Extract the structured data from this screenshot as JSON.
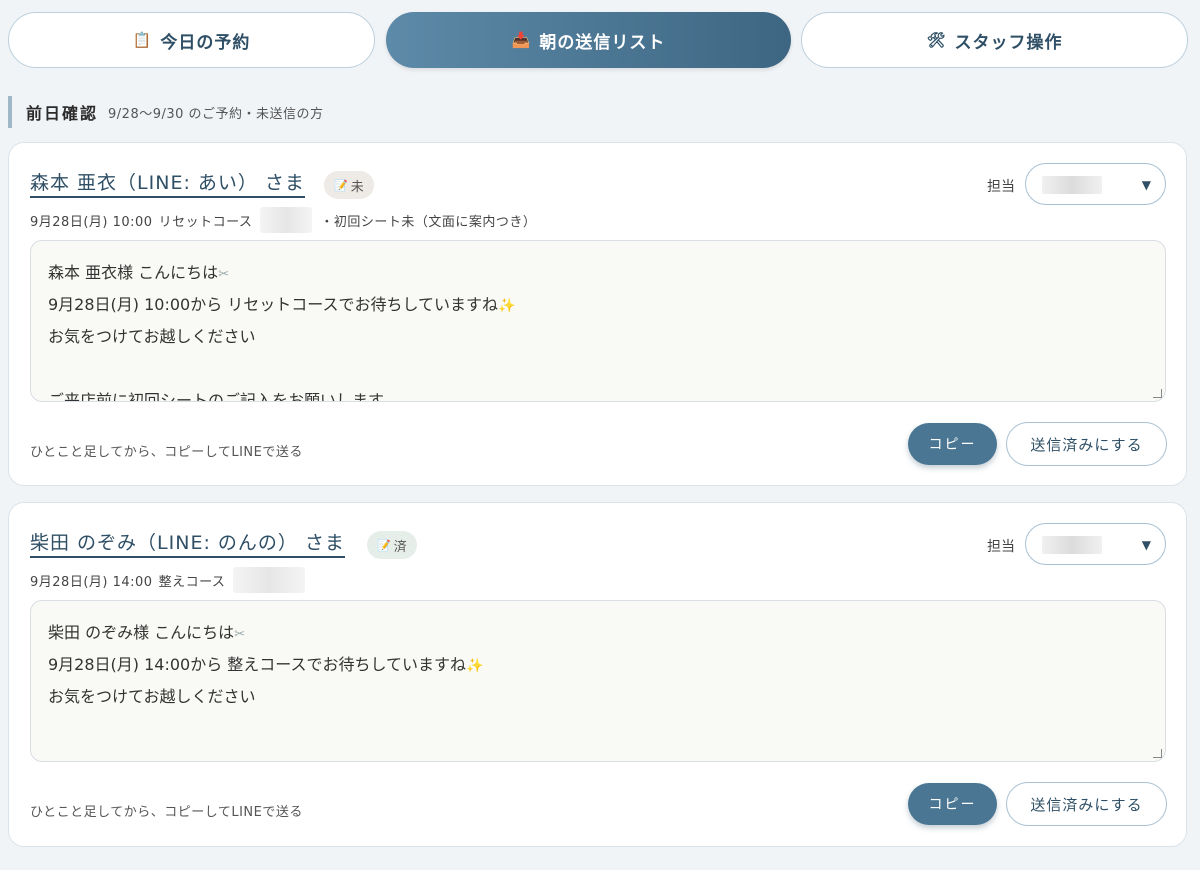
{
  "tabs": [
    {
      "icon": "📋",
      "label": "今日の予約",
      "active": false
    },
    {
      "icon": "📥",
      "label": "朝の送信リスト",
      "active": true
    },
    {
      "icon": "🛠",
      "label": "スタッフ操作",
      "active": false
    }
  ],
  "section": {
    "title": "前日確認",
    "subtitle": "9/28〜9/30 のご予約・未送信の方"
  },
  "staff_label": "担当",
  "hint": "ひとこと足してから、コピーしてLINEで送る",
  "copy_label": "コピー",
  "sent_label": "送信済みにする",
  "cards": [
    {
      "name": "森本 亜衣（LINE: あい） さま",
      "badge": "未",
      "datetime": "9月28日(月) 10:00",
      "course": "リセットコース",
      "extra": "・初回シート未（文面に案内つき）",
      "message": [
        "森本 亜衣様 こんにちは",
        "9月28日(月) 10:00から リセットコースでお待ちしていますね",
        "お気をつけてお越しください",
        "",
        "ご来店前に初回シートのご記入をお願いします"
      ]
    },
    {
      "name": "柴田 のぞみ（LINE: のんの） さま",
      "badge": "済",
      "datetime": "9月28日(月) 14:00",
      "course": "整えコース",
      "extra": "",
      "message": [
        "柴田 のぞみ様 こんにちは",
        "9月28日(月) 14:00から 整えコースでお待ちしていますね",
        "お気をつけてお越しください"
      ]
    }
  ]
}
